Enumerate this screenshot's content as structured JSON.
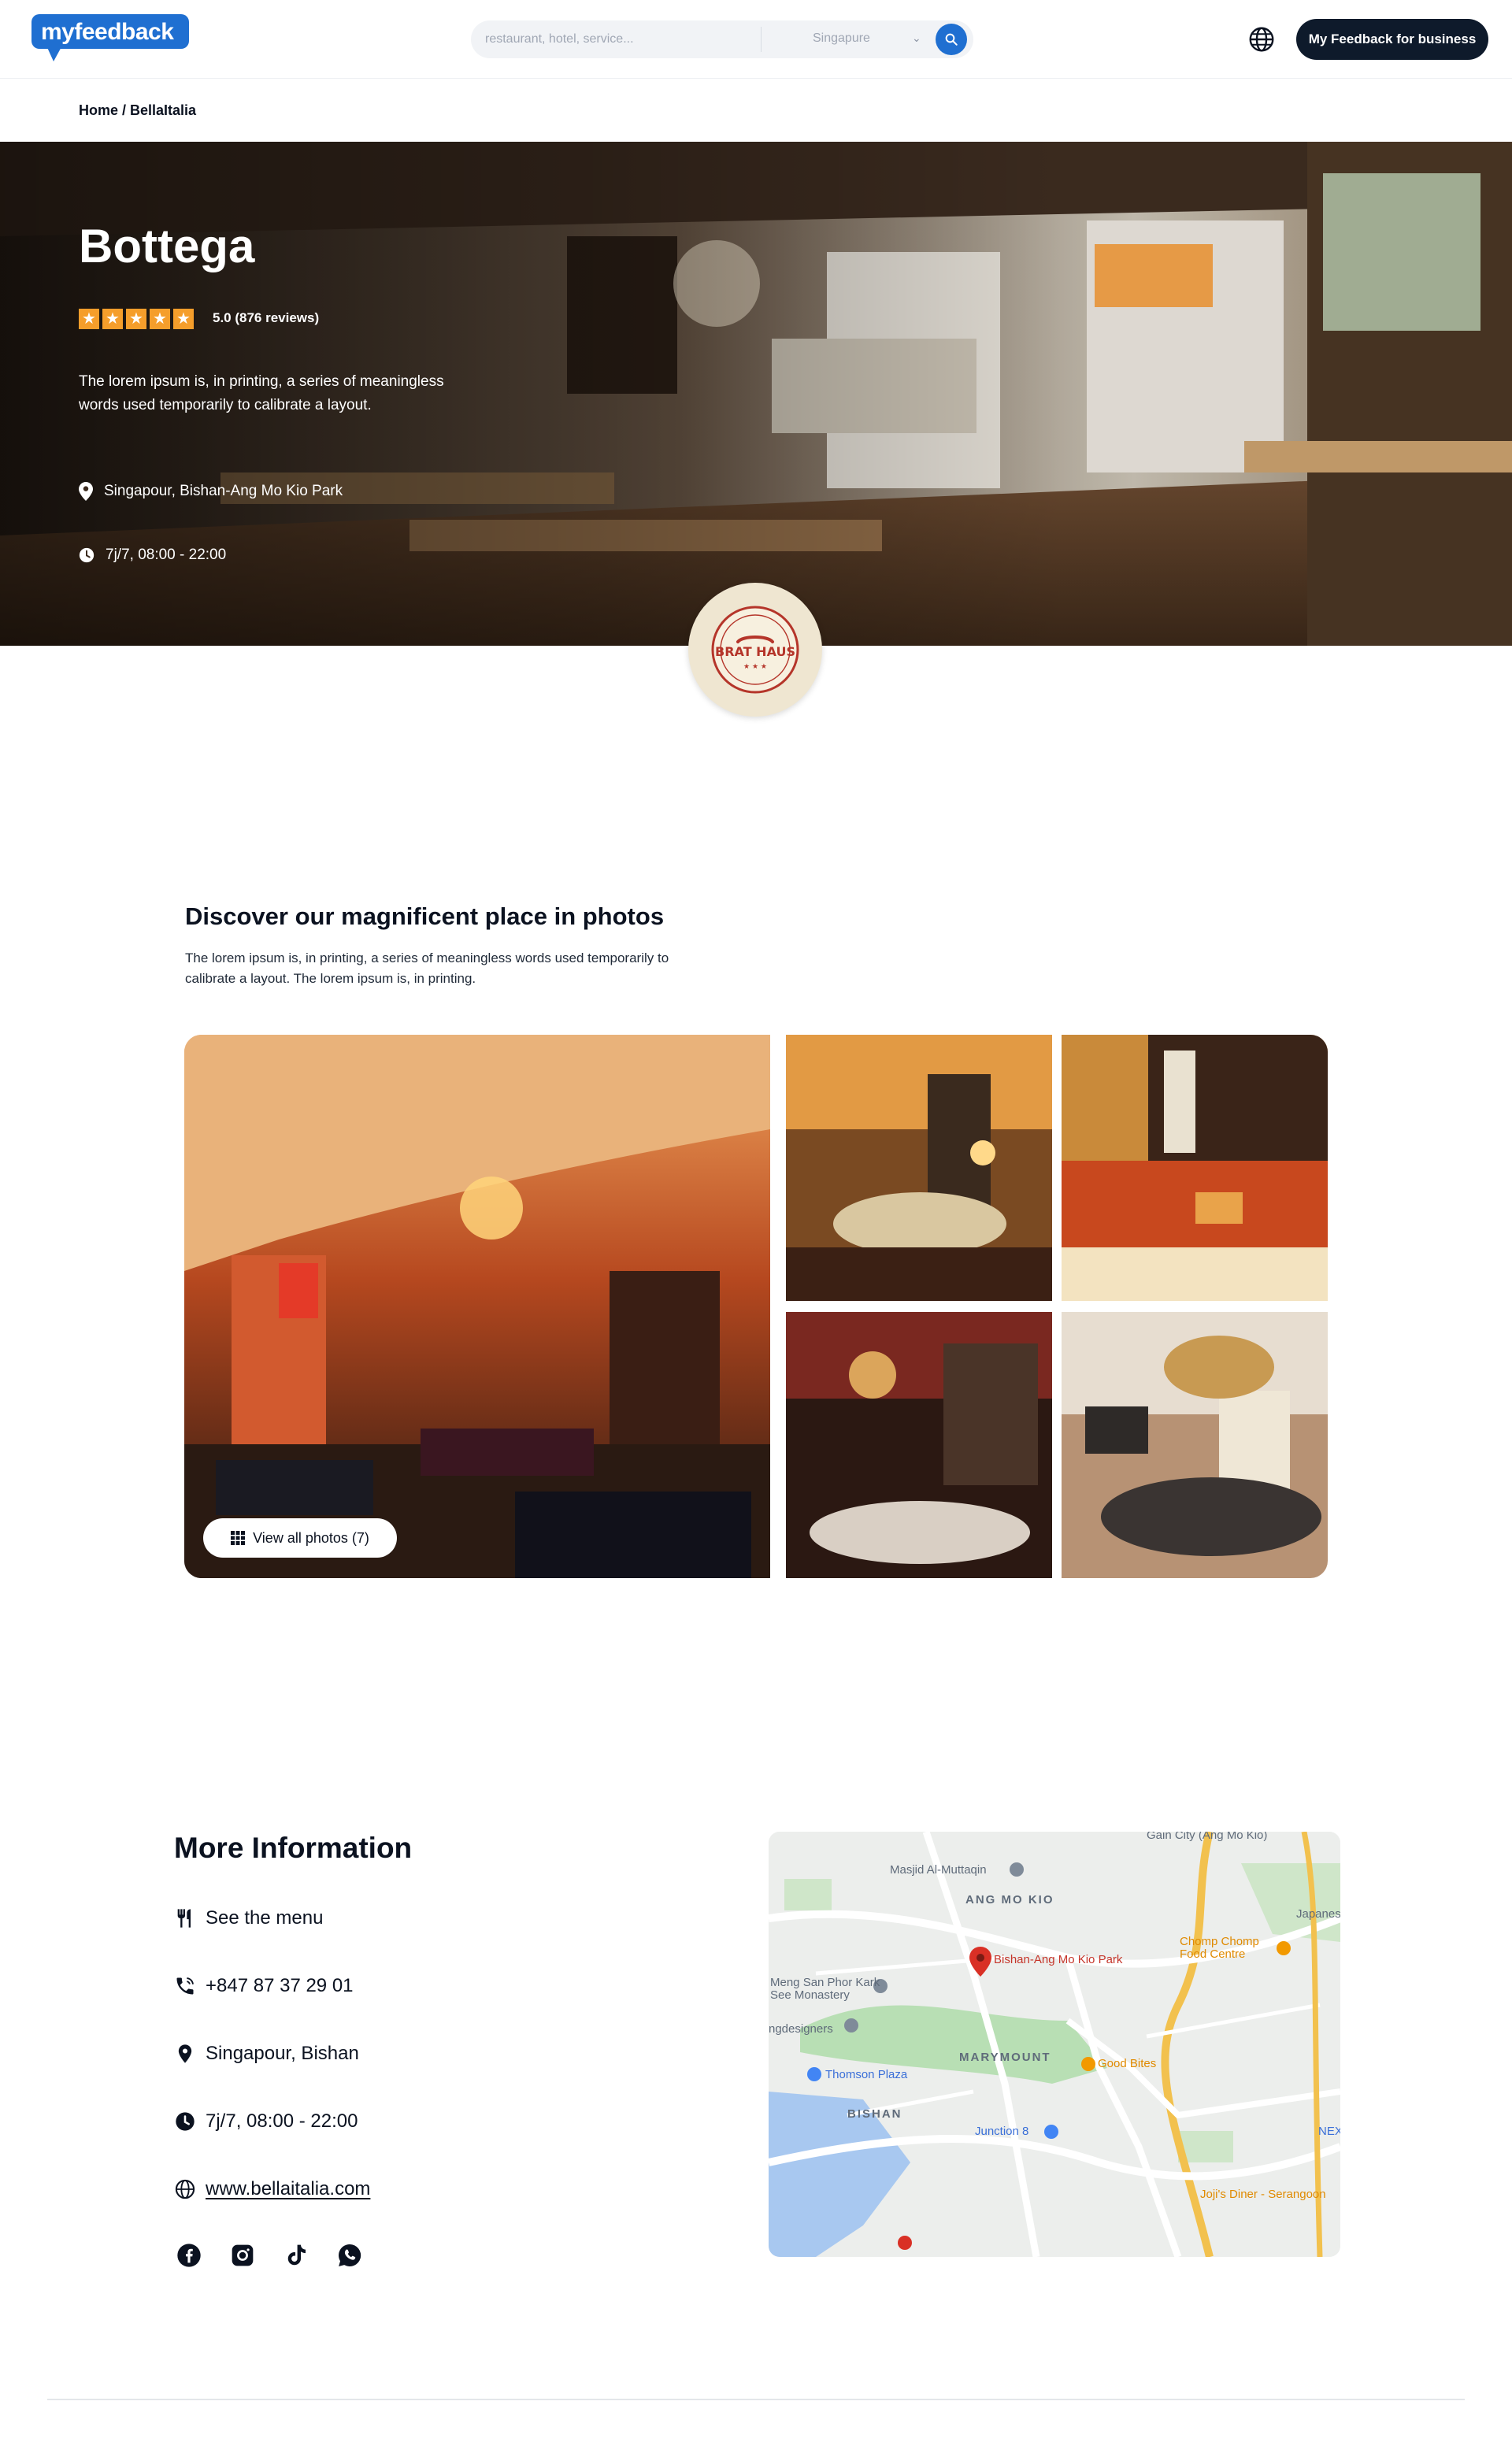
{
  "header": {
    "logo_text": "myfeedback",
    "search_placeholder": "restaurant, hotel, service...",
    "location": "Singapure",
    "business_button": "My Feedback for business"
  },
  "breadcrumb": "Home / BellaItalia",
  "hero": {
    "title": "Bottega",
    "rating_text": "5.0 (876 reviews)",
    "stars": 5,
    "description": "The lorem ipsum is, in printing, a series of meaningless words used temporarily to calibrate a layout.",
    "address": "Singapour, Bishan-Ang Mo Kio Park",
    "hours": "7j/7, 08:00 - 22:00",
    "badge_text": "BRAT HAUS"
  },
  "photos": {
    "title": "Discover our magnificent place in photos",
    "description": "The lorem ipsum is, in printing, a series of meaningless words used temporarily to calibrate a layout. The lorem ipsum is, in printing.",
    "view_all": "View all photos (7)"
  },
  "more_info": {
    "title": "More Information",
    "menu": "See the menu",
    "phone": "+847 87 37 29 01",
    "address": "Singapour, Bishan",
    "hours": "7j/7, 08:00 - 22:00",
    "website": "www.bellaitalia.com",
    "socials": [
      "facebook-icon",
      "instagram-icon",
      "tiktok-icon",
      "whatsapp-icon"
    ]
  },
  "map": {
    "labels": [
      "Gain City (Ang Mo Kio)",
      "Masjid Al-Muttaqin",
      "ANG MO KIO",
      "Bishan-Ang Mo Kio Park",
      "Chomp Chomp Food Centre",
      "Japanese",
      "Meng San Phor Kark See Monastery",
      "MARYMOUNT",
      "Good Bites",
      "Thomson Plaza",
      "BISHAN",
      "Junction 8",
      "Joji's Diner - Serangoon",
      "ngdesigners",
      "NEX"
    ]
  },
  "colors": {
    "brand_blue": "#1f6fd1",
    "dark_button": "#0e1a2b",
    "star_orange": "#f59e2b"
  }
}
